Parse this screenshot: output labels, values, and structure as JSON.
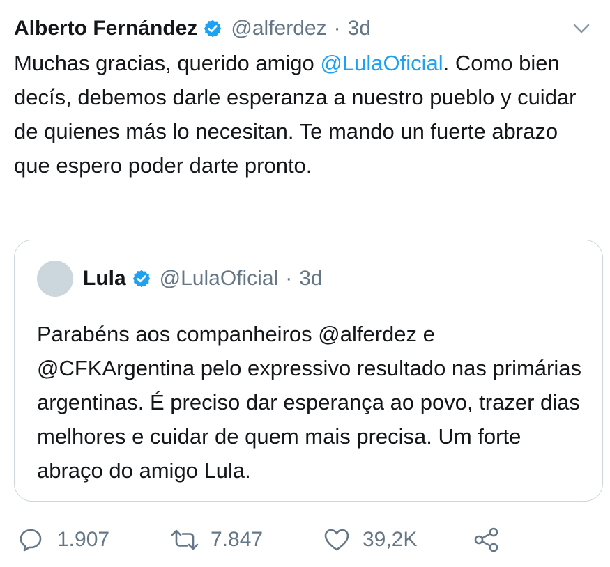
{
  "tweet": {
    "author_name": "Alberto Fernández",
    "handle": "@alferdez",
    "separator": "·",
    "time": "3d",
    "text_before": "Muchas gracias, querido amigo ",
    "mention": "@LulaOficial",
    "text_after": ". Como bien decís, debemos darle esperanza a nuestro pueblo y cuidar de quienes más lo necesitan. Te mando un fuerte abrazo que espero poder darte pronto."
  },
  "quoted": {
    "author_name": "Lula",
    "handle": "@LulaOficial",
    "separator": "·",
    "time": "3d",
    "text": "Parabéns aos companheiros @alferdez e @CFKArgentina pelo expressivo resultado nas primárias argentinas. É preciso dar esperança ao povo, trazer dias melhores e cuidar de quem mais precisa. Um forte abraço do amigo Lula."
  },
  "actions": {
    "reply_count": "1.907",
    "retweet_count": "7.847",
    "like_count": "39,2K"
  },
  "icons": {
    "verified": "verified-badge-icon",
    "menu": "chevron-down-icon",
    "reply": "reply-icon",
    "retweet": "retweet-icon",
    "like": "heart-icon",
    "share": "share-icon"
  },
  "colors": {
    "accent": "#1da1f2",
    "secondary_text": "#657786",
    "border": "#ccd6dd",
    "text": "#14171a"
  }
}
